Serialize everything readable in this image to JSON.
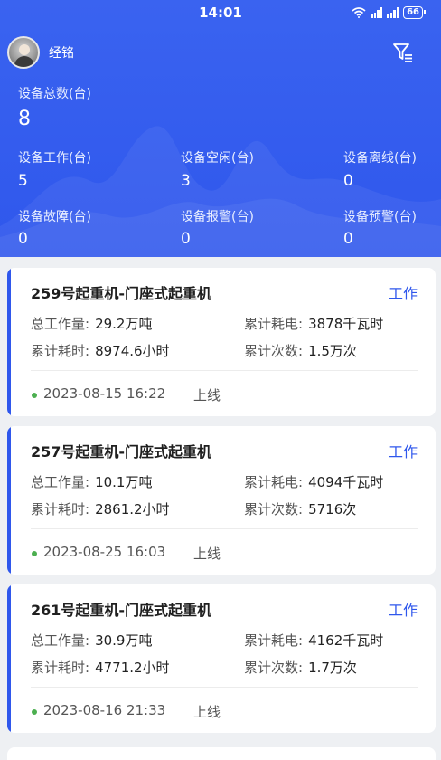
{
  "status_bar": {
    "time": "14:01",
    "battery": "66"
  },
  "user": {
    "name": "经铭"
  },
  "summary": {
    "total_label": "设备总数(台)",
    "total_value": "8",
    "stats": [
      {
        "label": "设备工作(台)",
        "value": "5"
      },
      {
        "label": "设备空闲(台)",
        "value": "3"
      },
      {
        "label": "设备离线(台)",
        "value": "0"
      },
      {
        "label": "设备故障(台)",
        "value": "0"
      },
      {
        "label": "设备报警(台)",
        "value": "0"
      },
      {
        "label": "设备预警(台)",
        "value": "0"
      }
    ]
  },
  "labels": {
    "total_work": "总工作量:",
    "energy": "累计耗电:",
    "hours": "累计耗时:",
    "count": "累计次数:"
  },
  "devices": [
    {
      "name": "259号起重机-门座式起重机",
      "status": "工作",
      "total_work": "29.2万吨",
      "energy": "3878千瓦时",
      "hours": "8974.6小时",
      "count": "1.5万次",
      "time": "2023-08-15 16:22",
      "online": "上线"
    },
    {
      "name": "257号起重机-门座式起重机",
      "status": "工作",
      "total_work": "10.1万吨",
      "energy": "4094千瓦时",
      "hours": "2861.2小时",
      "count": "5716次",
      "time": "2023-08-25 16:03",
      "online": "上线"
    },
    {
      "name": "261号起重机-门座式起重机",
      "status": "工作",
      "total_work": "30.9万吨",
      "energy": "4162千瓦时",
      "hours": "4771.2小时",
      "count": "1.7万次",
      "time": "2023-08-16 21:33",
      "online": "上线"
    }
  ],
  "colors": {
    "primary": "#2f57ec",
    "online_dot": "#4caf50",
    "background": "#eef0f3"
  },
  "icons": {
    "filter": "filter-icon",
    "wifi": "wifi-icon",
    "signal": "signal-icon",
    "battery": "battery-icon"
  }
}
